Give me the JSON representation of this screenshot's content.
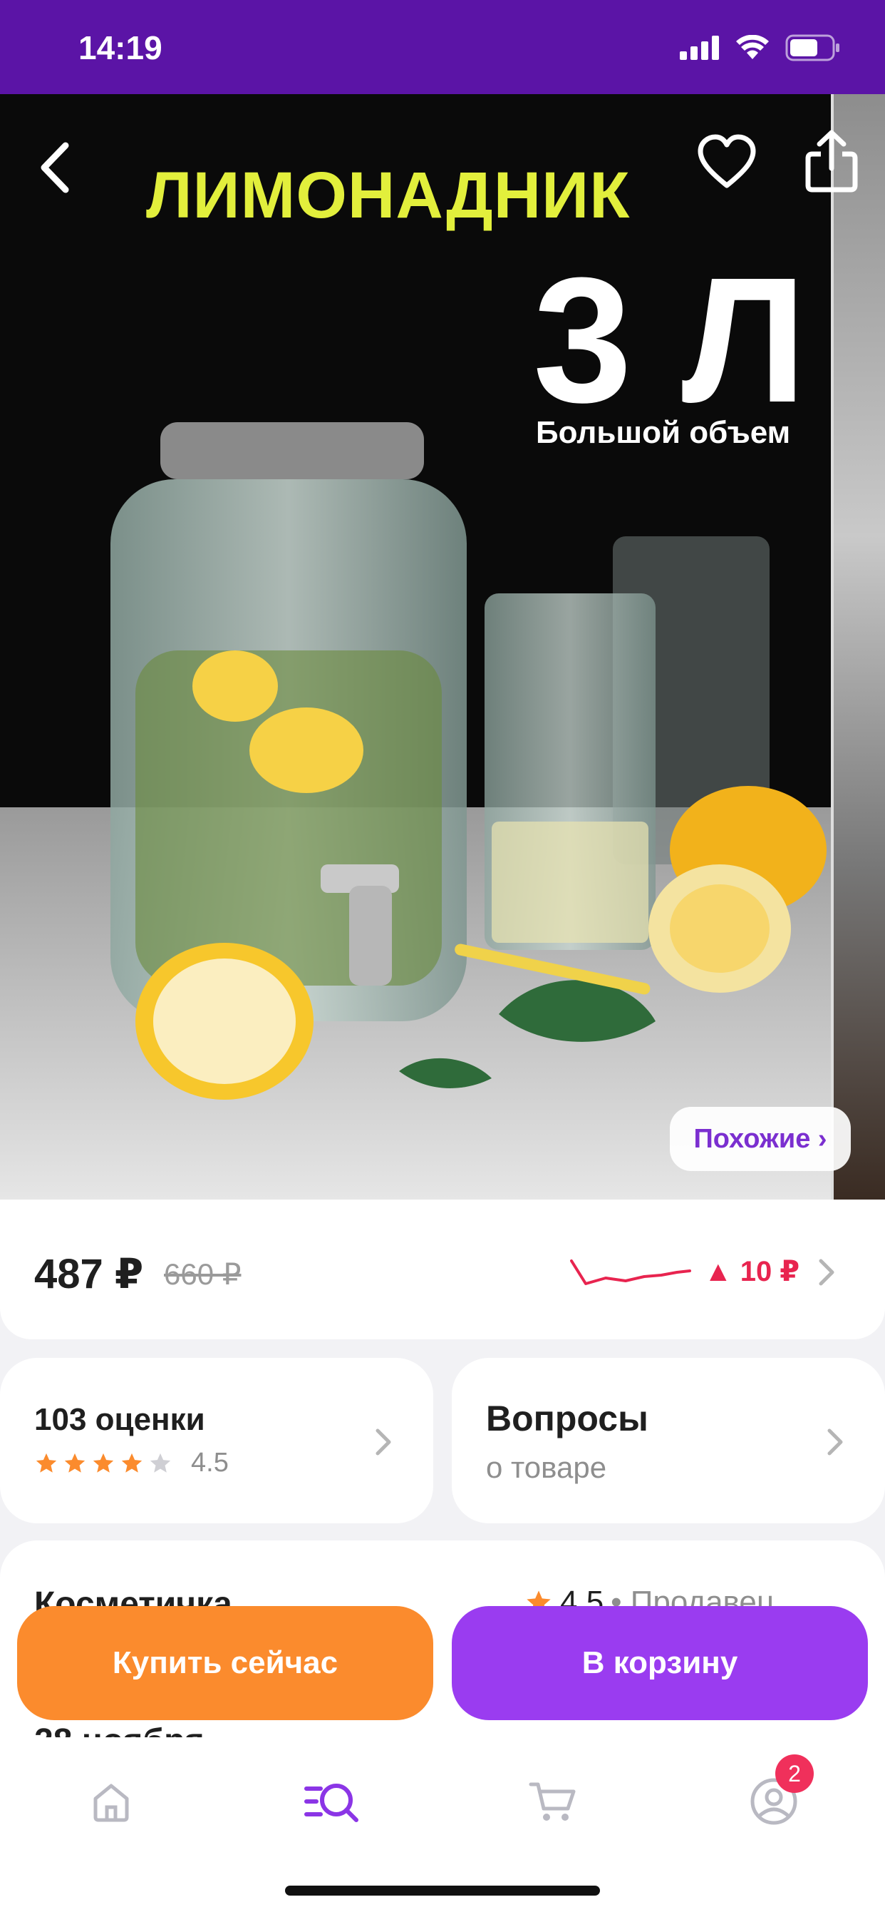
{
  "status_bar": {
    "time": "14:19"
  },
  "hero": {
    "title": "ЛИМОНАДНИК",
    "big": "3 Л",
    "subtitle": "Большой объем",
    "similar_label": "Похожие ›"
  },
  "price": {
    "current": "487 ₽",
    "old": "660 ₽",
    "change": "▲ 10 ₽",
    "trend_color": "#e8244f"
  },
  "rating_card": {
    "title": "103 оценки",
    "value": "4.5",
    "stars_filled": 4
  },
  "questions_card": {
    "title": "Вопросы",
    "subtitle": "о товаре"
  },
  "seller_card": {
    "name": "Косметичка",
    "rating": "4.5",
    "label": "• Продавец"
  },
  "delivery": {
    "date": "28 ноября"
  },
  "actions": {
    "buy_now": "Купить сейчас",
    "add_to_cart": "В корзину"
  },
  "tabbar": {
    "profile_badge": "2",
    "active_tab": "catalog"
  },
  "colors": {
    "brand": "#5b14a6",
    "accent_purple": "#9a3cf0",
    "accent_orange": "#fb8b2d"
  }
}
